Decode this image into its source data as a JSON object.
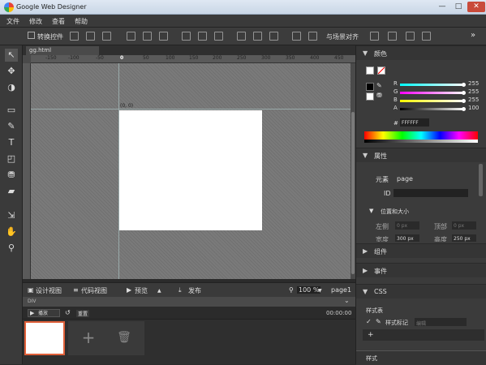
{
  "window": {
    "title": "Google Web Designer",
    "controls": [
      "—",
      "□",
      "✕"
    ]
  },
  "menu": [
    "文件",
    "修改",
    "查看",
    "帮助"
  ],
  "toolbar": {
    "toggle_controls": "转换控件",
    "align_label": "与场景对齐"
  },
  "document": {
    "tab": "gg.html",
    "origin_label": "(0, 0)"
  },
  "ruler": {
    "top": [
      "-150",
      "-100",
      "-50",
      "0",
      "50",
      "100",
      "150",
      "200",
      "250",
      "300",
      "350",
      "400",
      "450"
    ]
  },
  "bottombar": {
    "design_view": "设计视图",
    "code_view": "代码视图",
    "preview": "预览",
    "publish": "发布",
    "zoom": "100",
    "zoom_unit": "%",
    "page": "page1"
  },
  "timeline": {
    "element": "DIV",
    "play": "播放",
    "reset": "重置",
    "time": "00:00:00",
    "add": "+"
  },
  "colors_panel": {
    "title": "颜色",
    "r_label": "R",
    "g_label": "G",
    "b_label": "B",
    "a_label": "A",
    "r": "255",
    "g": "255",
    "b": "255",
    "a": "100",
    "hex_prefix": "#",
    "hex": "FFFFFF"
  },
  "properties_panel": {
    "title": "属性",
    "element_label": "元素",
    "element_value": "page",
    "id_label": "ID",
    "pos_size_title": "位置和大小",
    "left_label": "左侧",
    "left_unit": "0 px",
    "top_label": "顶部",
    "top_unit": "0 px",
    "width_label": "宽度",
    "width_value": "300 px",
    "height_label": "高度",
    "height_value": "250 px"
  },
  "components_panel": {
    "title": "组件"
  },
  "events_panel": {
    "title": "事件"
  },
  "css_panel": {
    "title": "CSS",
    "stylesheets_label": "样式表",
    "style_tag": "样式标记",
    "filter_placeholder": "编辑",
    "add": "+"
  },
  "styles_panel": {
    "title": "样式"
  },
  "accent_colors": {
    "red": "#ff4040",
    "green": "#30d030",
    "blue": "#30a0ff",
    "active_thumb_border": "#e0603a"
  }
}
